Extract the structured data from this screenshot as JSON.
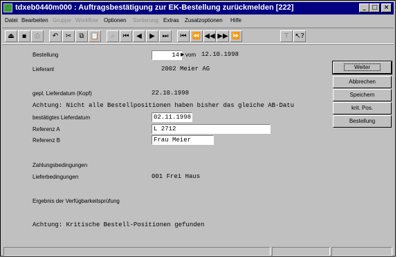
{
  "window": {
    "title": "tdxeb0440m000 : Auftragsbestätigung zur EK-Bestellung zurückmelden [222]",
    "minimize_glyph": "_",
    "maximize_glyph": "□",
    "close_glyph": "×",
    "titlebar_color": "#000080"
  },
  "menu": {
    "items": [
      {
        "label": "Datei",
        "disabled": false
      },
      {
        "label": "Bearbeiten",
        "disabled": false
      },
      {
        "label": "Gruppe",
        "disabled": true
      },
      {
        "label": "Workflow",
        "disabled": true
      },
      {
        "label": "Optionen",
        "disabled": false
      },
      {
        "label": "Sortierung",
        "disabled": true
      },
      {
        "label": "Extras",
        "disabled": false
      },
      {
        "label": "Zusatzoptionen",
        "disabled": false
      },
      {
        "label": "Hilfe",
        "disabled": false
      }
    ]
  },
  "toolbar": {
    "icons": [
      "exit-icon",
      "save-icon",
      "print-icon",
      "undo-icon",
      "cut-icon",
      "copy-icon",
      "paste-icon",
      "find-icon",
      "first-record-icon",
      "previous-record-icon",
      "next-record-icon",
      "last-record-icon",
      "first-group-icon",
      "previous-page-icon",
      "previous-fast-icon",
      "next-fast-icon",
      "next-page-icon",
      "text-icon",
      "help-pointer-icon"
    ]
  },
  "form": {
    "bestellung_label": "Bestellung",
    "bestellung_value": "14",
    "vom_label": "vom",
    "vom_value": "12.10.1998",
    "lieferant_label": "Lieferant",
    "lieferant_value": "2002 Meier AG",
    "gepl_lieferdatum_label": "gepl. Lieferdatum (Kopf)",
    "gepl_lieferdatum_value": "22.10.1998",
    "warning_ab": "Achtung: Nicht alle Bestellpositionen haben bisher das gleiche AB-Datu",
    "bestaetigtes_label": "bestätigtes Lieferdatum",
    "bestaetigtes_value": "02.11.1998",
    "referenz_a_label": "Referenz A",
    "referenz_a_value": "L 2712",
    "referenz_b_label": "Referenz B",
    "referenz_b_value": "Frau Meier",
    "zahlung_label": "Zahlungsbedingungen",
    "liefer_label": "Lieferbedingungen",
    "liefer_value": "001 Frei Haus",
    "ergebnis_label": "Ergebnis der Verfügbarkeitsprüfung",
    "warning_kritisch": "Achtung: Kritische Bestell-Positionen gefunden"
  },
  "buttons": {
    "weiter": "Weiter",
    "abbrechen": "Abbrechen",
    "speichern": "Speichern",
    "krit_pos": "krit. Pos.",
    "bestellung": "Bestellung"
  }
}
